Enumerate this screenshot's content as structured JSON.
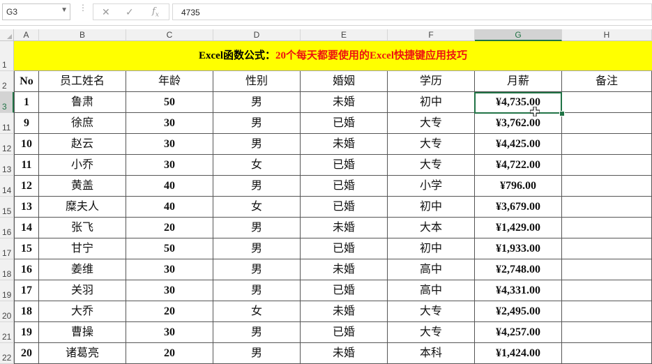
{
  "formula_bar": {
    "name_box": "G3",
    "formula": "4735",
    "icons": [
      "cancel-icon",
      "confirm-icon",
      "fx-icon"
    ]
  },
  "columns": [
    "A",
    "B",
    "C",
    "D",
    "E",
    "F",
    "G",
    "H"
  ],
  "selected_column": "G",
  "selected_row": "3",
  "title": {
    "part1": "Excel函数公式：",
    "part2": "20个每天都要使用的Excel快捷键应用技巧",
    "colors": {
      "part1": "#000000",
      "part2": "#ee1111",
      "background": "#ffff00"
    }
  },
  "table": {
    "headers": [
      "No",
      "员工姓名",
      "年龄",
      "性别",
      "婚姻",
      "学历",
      "月薪",
      "备注"
    ],
    "rows": [
      {
        "row_label": "3",
        "cells": [
          "1",
          "鲁肃",
          "50",
          "男",
          "未婚",
          "初中",
          "¥4,735.00",
          ""
        ]
      },
      {
        "row_label": "11",
        "cells": [
          "9",
          "徐庶",
          "30",
          "男",
          "已婚",
          "大专",
          "¥3,762.00",
          ""
        ]
      },
      {
        "row_label": "12",
        "cells": [
          "10",
          "赵云",
          "30",
          "男",
          "未婚",
          "大专",
          "¥4,425.00",
          ""
        ]
      },
      {
        "row_label": "13",
        "cells": [
          "11",
          "小乔",
          "30",
          "女",
          "已婚",
          "大专",
          "¥4,722.00",
          ""
        ]
      },
      {
        "row_label": "14",
        "cells": [
          "12",
          "黄盖",
          "40",
          "男",
          "已婚",
          "小学",
          "¥796.00",
          ""
        ]
      },
      {
        "row_label": "15",
        "cells": [
          "13",
          "糜夫人",
          "40",
          "女",
          "已婚",
          "初中",
          "¥3,679.00",
          ""
        ]
      },
      {
        "row_label": "16",
        "cells": [
          "14",
          "张飞",
          "20",
          "男",
          "未婚",
          "大本",
          "¥1,429.00",
          ""
        ]
      },
      {
        "row_label": "17",
        "cells": [
          "15",
          "甘宁",
          "50",
          "男",
          "已婚",
          "初中",
          "¥1,933.00",
          ""
        ]
      },
      {
        "row_label": "18",
        "cells": [
          "16",
          "姜维",
          "30",
          "男",
          "未婚",
          "高中",
          "¥2,748.00",
          ""
        ]
      },
      {
        "row_label": "19",
        "cells": [
          "17",
          "关羽",
          "30",
          "男",
          "已婚",
          "高中",
          "¥4,331.00",
          ""
        ]
      },
      {
        "row_label": "20",
        "cells": [
          "18",
          "大乔",
          "20",
          "女",
          "未婚",
          "大专",
          "¥2,495.00",
          ""
        ]
      },
      {
        "row_label": "21",
        "cells": [
          "19",
          "曹操",
          "30",
          "男",
          "已婚",
          "大专",
          "¥4,257.00",
          ""
        ]
      },
      {
        "row_label": "22",
        "cells": [
          "20",
          "诸葛亮",
          "20",
          "男",
          "未婚",
          "本科",
          "¥1,424.00",
          ""
        ]
      }
    ]
  },
  "row_labels_top": [
    "1",
    "2"
  ],
  "accent_color": "#217346"
}
